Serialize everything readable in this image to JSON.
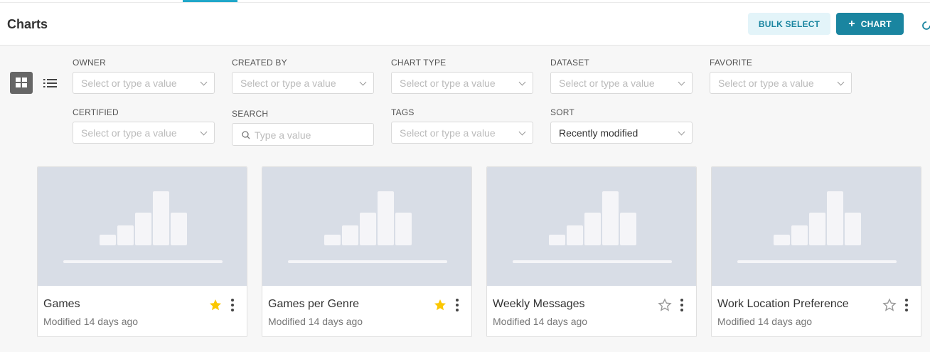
{
  "header": {
    "title": "Charts",
    "bulk_select_label": "BULK SELECT",
    "add_chart_label": "CHART",
    "add_chart_plus": "+"
  },
  "filters": {
    "owner": {
      "label": "OWNER",
      "placeholder": "Select or type a value"
    },
    "created_by": {
      "label": "CREATED BY",
      "placeholder": "Select or type a value"
    },
    "chart_type": {
      "label": "CHART TYPE",
      "placeholder": "Select or type a value"
    },
    "dataset": {
      "label": "DATASET",
      "placeholder": "Select or type a value"
    },
    "favorite": {
      "label": "FAVORITE",
      "placeholder": "Select or type a value"
    },
    "certified": {
      "label": "CERTIFIED",
      "placeholder": "Select or type a value"
    },
    "search": {
      "label": "SEARCH",
      "placeholder": "Type a value"
    },
    "tags": {
      "label": "TAGS",
      "placeholder": "Select or type a value"
    },
    "sort": {
      "label": "SORT",
      "value": "Recently modified"
    }
  },
  "cards": [
    {
      "name": "Games",
      "modified": "Modified 14 days ago",
      "favorite": true
    },
    {
      "name": "Games per Genre",
      "modified": "Modified 14 days ago",
      "favorite": true
    },
    {
      "name": "Weekly Messages",
      "modified": "Modified 14 days ago",
      "favorite": false
    },
    {
      "name": "Work Location Preference",
      "modified": "Modified 14 days ago",
      "favorite": false
    }
  ],
  "colors": {
    "primary": "#1a85a0",
    "star_active": "#fbc700",
    "star_inactive": "#999999",
    "thumbnail_bg": "#d8dde6"
  }
}
